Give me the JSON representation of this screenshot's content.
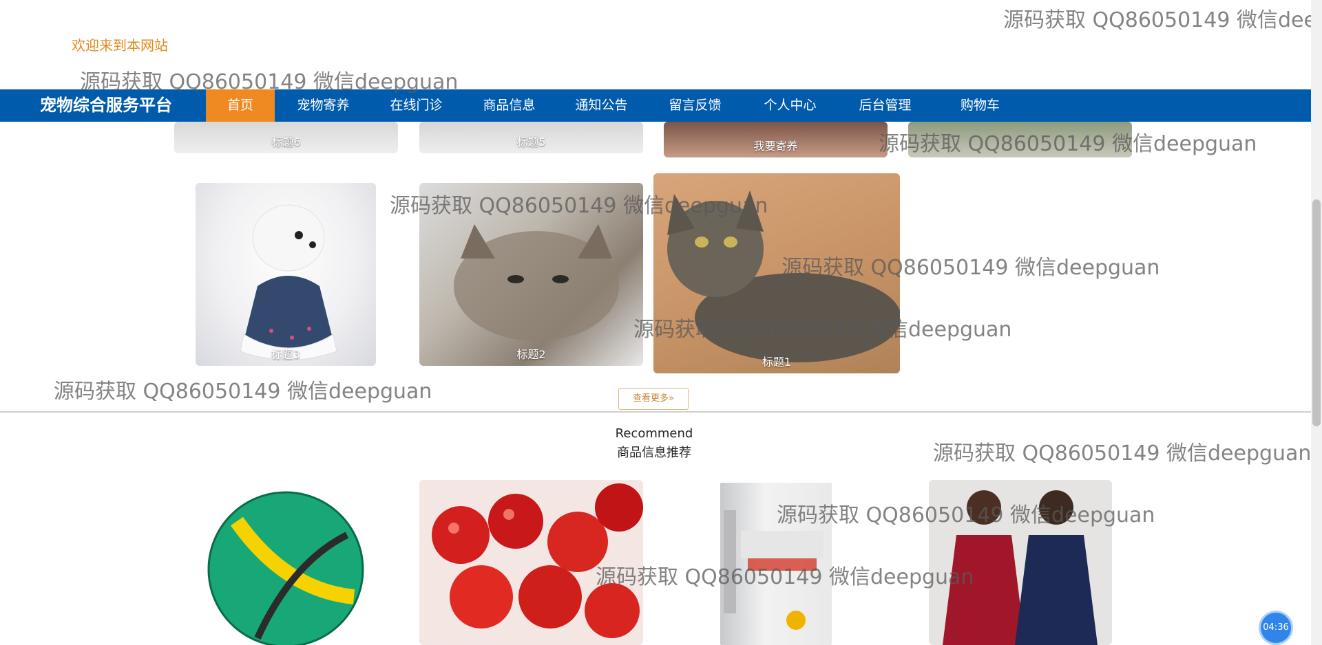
{
  "header": {
    "welcome": "欢迎来到本网站"
  },
  "nav": {
    "brand": "宠物综合服务平台",
    "items": [
      "首页",
      "宠物寄养",
      "在线门诊",
      "商品信息",
      "通知公告",
      "留言反馈",
      "个人中心",
      "后台管理",
      "购物车"
    ]
  },
  "pet_gallery": {
    "top_row": [
      "标题6",
      "标题5",
      "我要寄养"
    ],
    "bottom_row": [
      "标题3",
      "标题2",
      "标题1"
    ],
    "more_label": "查看更多»"
  },
  "recommend": {
    "title": "Recommend",
    "subtitle": "商品信息推荐"
  },
  "watermark": "源码获取 QQ86050149 微信deepguan",
  "watermark_clipped": "源码获取 QQ86050149 微信deep",
  "timer": "04:36"
}
